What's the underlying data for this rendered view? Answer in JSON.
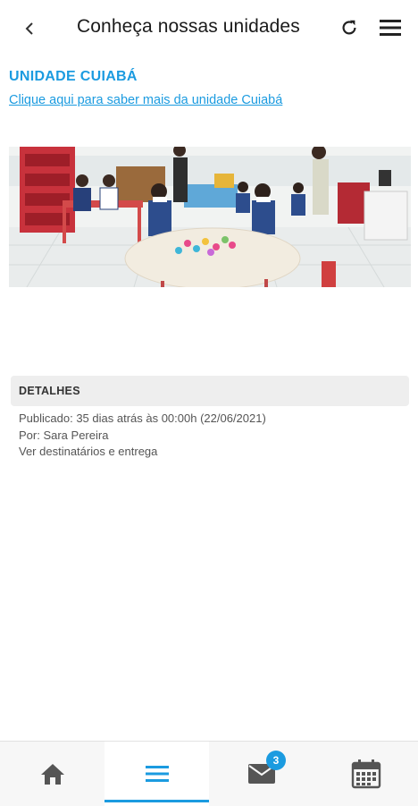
{
  "header": {
    "title": "Conheça nossas unidades",
    "back_icon": "chevron-left-icon",
    "refresh_icon": "refresh-icon",
    "menu_icon": "hamburger-menu-icon"
  },
  "post": {
    "unit_title": "UNIDADE CUIABÁ",
    "link_text": "Clique aqui para saber mais da unidade Cuiabá",
    "image_icon": "classroom-photo"
  },
  "details": {
    "header": "DETALHES",
    "published": "Publicado: 35 dias atrás às 00:00h (22/06/2021)",
    "author": "Por: Sara Pereira",
    "recipients_link": "Ver destinatários e entrega"
  },
  "bottom_nav": {
    "items": [
      {
        "name": "home",
        "icon": "home-icon"
      },
      {
        "name": "menu",
        "icon": "list-icon",
        "active": true
      },
      {
        "name": "messages",
        "icon": "mail-icon",
        "badge": "3"
      },
      {
        "name": "calendar",
        "icon": "calendar-icon"
      }
    ]
  },
  "colors": {
    "accent": "#1b9be0",
    "header_bg": "#ffffff",
    "details_bg": "#eeeeee",
    "nav_bg": "#f7f7f7"
  }
}
